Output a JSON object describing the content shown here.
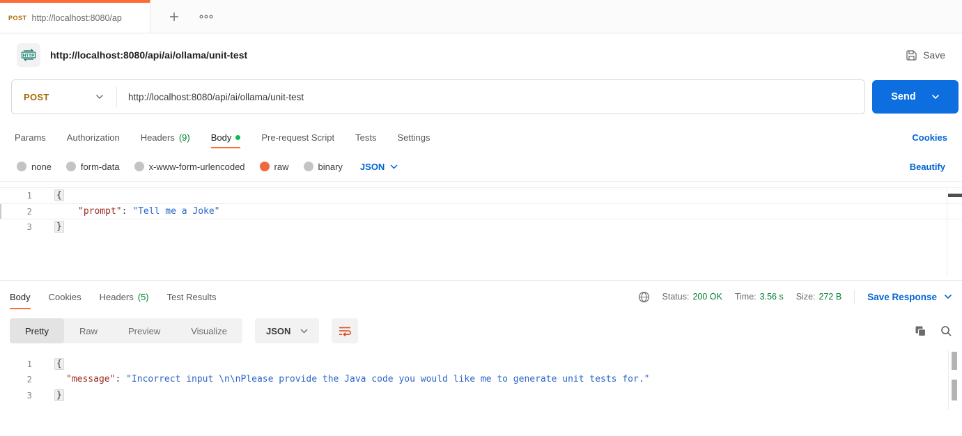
{
  "colors": {
    "accent_orange": "#ff6c37",
    "link_blue": "#0265d2",
    "send_blue": "#0d6ee0",
    "success_green": "#007f31",
    "unsaved_dot_green": "#0cbb52",
    "method_post_amber": "#a86a03",
    "http_icon_teal": "#0e7569",
    "editor_key": "#9e2b20",
    "editor_value": "#2b66c9",
    "wrap_icon_orange": "#dd4b1f"
  },
  "tabbar": {
    "active_tab": {
      "method": "POST",
      "url": "http://localhost:8080/ap"
    }
  },
  "request": {
    "title": "http://localhost:8080/api/ai/ollama/unit-test",
    "save_label": "Save",
    "method": "POST",
    "url": "http://localhost:8080/api/ai/ollama/unit-test",
    "send_label": "Send",
    "tabs": [
      {
        "label": "Params"
      },
      {
        "label": "Authorization"
      },
      {
        "label": "Headers",
        "count": "(9)"
      },
      {
        "label": "Body"
      },
      {
        "label": "Pre-request Script"
      },
      {
        "label": "Tests"
      },
      {
        "label": "Settings"
      }
    ],
    "cookies_link": "Cookies",
    "body_types": [
      "none",
      "form-data",
      "x-www-form-urlencoded",
      "raw",
      "binary"
    ],
    "selected_body_type": "raw",
    "language": "JSON",
    "beautify_link": "Beautify",
    "editor": {
      "lines": [
        {
          "num": "1",
          "code": "{"
        },
        {
          "num": "2",
          "key": "\"prompt\"",
          "sep": ": ",
          "value": "\"Tell me a Joke\""
        },
        {
          "num": "3",
          "code": "}"
        }
      ]
    }
  },
  "response": {
    "tabs": [
      {
        "label": "Body"
      },
      {
        "label": "Cookies"
      },
      {
        "label": "Headers",
        "count": "(5)"
      },
      {
        "label": "Test Results"
      }
    ],
    "meta": {
      "status_label": "Status:",
      "status_value": "200 OK",
      "time_label": "Time:",
      "time_value": "3.56 s",
      "size_label": "Size:",
      "size_value": "272 B"
    },
    "save_response_label": "Save Response",
    "view_tabs": [
      "Pretty",
      "Raw",
      "Preview",
      "Visualize"
    ],
    "active_view": "Pretty",
    "language": "JSON",
    "editor": {
      "lines": [
        {
          "num": "1",
          "code": "{"
        },
        {
          "num": "2",
          "key": "\"message\"",
          "sep": ": ",
          "value": "\"Incorrect input \\n\\nPlease provide the Java code you would like me to generate unit tests for.\""
        },
        {
          "num": "3",
          "code": "}"
        }
      ]
    }
  }
}
